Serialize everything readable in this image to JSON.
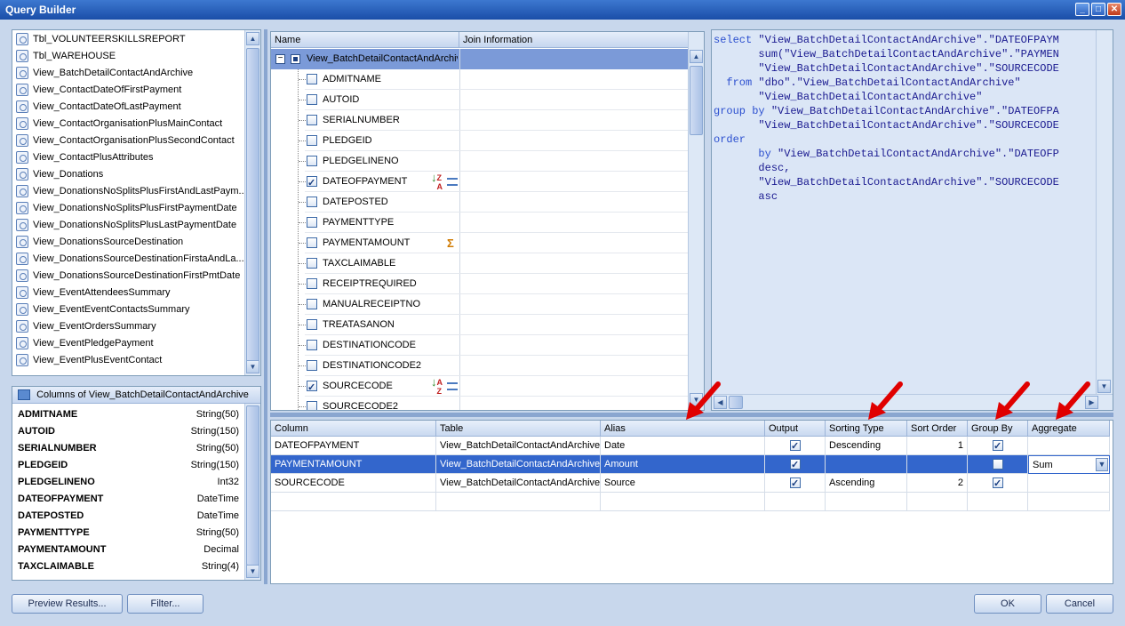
{
  "window": {
    "title": "Query Builder"
  },
  "tables": [
    "Tbl_VOLUNTEERSKILLSREPORT",
    "Tbl_WAREHOUSE",
    "View_BatchDetailContactAndArchive",
    "View_ContactDateOfFirstPayment",
    "View_ContactDateOfLastPayment",
    "View_ContactOrganisationPlusMainContact",
    "View_ContactOrganisationPlusSecondContact",
    "View_ContactPlusAttributes",
    "View_Donations",
    "View_DonationsNoSplitsPlusFirstAndLastPaym...",
    "View_DonationsNoSplitsPlusFirstPaymentDate",
    "View_DonationsNoSplitsPlusLastPaymentDate",
    "View_DonationsSourceDestination",
    "View_DonationsSourceDestinationFirstaAndLa...",
    "View_DonationsSourceDestinationFirstPmtDate",
    "View_EventAttendeesSummary",
    "View_EventEventContactsSummary",
    "View_EventOrdersSummary",
    "View_EventPledgePayment",
    "View_EventPlusEventContact"
  ],
  "columns_panel": {
    "title": "Columns of View_BatchDetailContactAndArchive",
    "rows": [
      {
        "name": "ADMITNAME",
        "type": "String(50)"
      },
      {
        "name": "AUTOID",
        "type": "String(150)"
      },
      {
        "name": "SERIALNUMBER",
        "type": "String(50)"
      },
      {
        "name": "PLEDGEID",
        "type": "String(150)"
      },
      {
        "name": "PLEDGELINENO",
        "type": "Int32"
      },
      {
        "name": "DATEOFPAYMENT",
        "type": "DateTime"
      },
      {
        "name": "DATEPOSTED",
        "type": "DateTime"
      },
      {
        "name": "PAYMENTTYPE",
        "type": "String(50)"
      },
      {
        "name": "PAYMENTAMOUNT",
        "type": "Decimal"
      },
      {
        "name": "TAXCLAIMABLE",
        "type": "String(4)"
      }
    ]
  },
  "tree": {
    "header_name": "Name",
    "header_join": "Join Information",
    "root": "View_BatchDetailContactAndArchive",
    "fields": [
      {
        "name": "ADMITNAME",
        "checked": false,
        "icon": ""
      },
      {
        "name": "AUTOID",
        "checked": false,
        "icon": ""
      },
      {
        "name": "SERIALNUMBER",
        "checked": false,
        "icon": ""
      },
      {
        "name": "PLEDGEID",
        "checked": false,
        "icon": ""
      },
      {
        "name": "PLEDGELINENO",
        "checked": false,
        "icon": ""
      },
      {
        "name": "DATEOFPAYMENT",
        "checked": true,
        "icon": "sort-desc-group"
      },
      {
        "name": "DATEPOSTED",
        "checked": false,
        "icon": ""
      },
      {
        "name": "PAYMENTTYPE",
        "checked": false,
        "icon": ""
      },
      {
        "name": "PAYMENTAMOUNT",
        "checked": false,
        "icon": "sum"
      },
      {
        "name": "TAXCLAIMABLE",
        "checked": false,
        "icon": ""
      },
      {
        "name": "RECEIPTREQUIRED",
        "checked": false,
        "icon": ""
      },
      {
        "name": "MANUALRECEIPTNO",
        "checked": false,
        "icon": ""
      },
      {
        "name": "TREATASANON",
        "checked": false,
        "icon": ""
      },
      {
        "name": "DESTINATIONCODE",
        "checked": false,
        "icon": ""
      },
      {
        "name": "DESTINATIONCODE2",
        "checked": false,
        "icon": ""
      },
      {
        "name": "SOURCECODE",
        "checked": true,
        "icon": "sort-asc-group"
      },
      {
        "name": "SOURCECODE2",
        "checked": false,
        "icon": ""
      }
    ]
  },
  "sql": [
    [
      "select ",
      "\"View_BatchDetailContactAndArchive\".\"DATEOFPAYM"
    ],
    [
      "       ",
      "sum(\"View_BatchDetailContactAndArchive\".\"PAYMEN"
    ],
    [
      "       ",
      "\"View_BatchDetailContactAndArchive\".\"SOURCECODE"
    ],
    [
      "  from ",
      "\"dbo\".\"View_BatchDetailContactAndArchive\""
    ],
    [
      "       ",
      "\"View_BatchDetailContactAndArchive\""
    ],
    [
      "group by ",
      "\"View_BatchDetailContactAndArchive\".\"DATEOFPA"
    ],
    [
      "       ",
      "\"View_BatchDetailContactAndArchive\".\"SOURCECODE"
    ],
    [
      "order",
      ""
    ],
    [
      "       by ",
      "\"View_BatchDetailContactAndArchive\".\"DATEOFP"
    ],
    [
      "       ",
      "desc,"
    ],
    [
      "       ",
      "\"View_BatchDetailContactAndArchive\".\"SOURCECODE"
    ],
    [
      "       ",
      "asc"
    ]
  ],
  "grid": {
    "headers": [
      "Column",
      "Table",
      "Alias",
      "Output",
      "Sorting Type",
      "Sort Order",
      "Group By",
      "Aggregate"
    ],
    "rows": [
      {
        "column": "DATEOFPAYMENT",
        "table": "View_BatchDetailContactAndArchive",
        "alias": "Date",
        "output": true,
        "sorting": "Descending",
        "order": "1",
        "group": true,
        "aggregate": ""
      },
      {
        "column": "PAYMENTAMOUNT",
        "table": "View_BatchDetailContactAndArchive",
        "alias": "Amount",
        "output": true,
        "sorting": "",
        "order": "",
        "group": false,
        "aggregate": "Sum"
      },
      {
        "column": "SOURCECODE",
        "table": "View_BatchDetailContactAndArchive",
        "alias": "Source",
        "output": true,
        "sorting": "Ascending",
        "order": "2",
        "group": true,
        "aggregate": ""
      }
    ]
  },
  "buttons": {
    "preview": "Preview Results...",
    "filter": "Filter...",
    "ok": "OK",
    "cancel": "Cancel"
  },
  "colors": {
    "selected_row": "#3366cc",
    "arrow": "#e00000"
  }
}
